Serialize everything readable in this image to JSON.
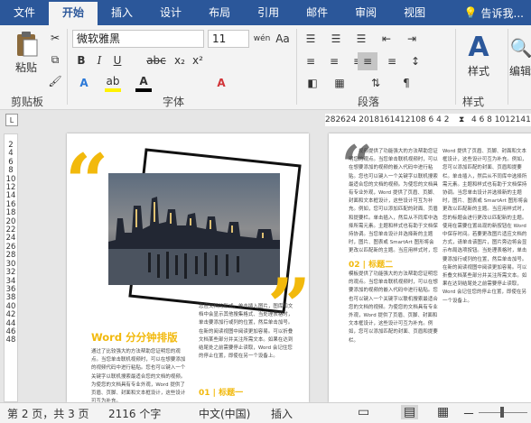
{
  "tabs": [
    "文件",
    "开始",
    "插入",
    "设计",
    "布局",
    "引用",
    "邮件",
    "审阅",
    "视图"
  ],
  "tell_me": "告诉我...",
  "ribbon": {
    "paste_label": "粘贴",
    "font_name": "微软雅黑",
    "font_size": "11",
    "styles_label": "样式",
    "edit_label": "编辑",
    "groups": {
      "clipboard": "剪贴板",
      "font": "字体",
      "paragraph": "段落",
      "styles": "样式"
    }
  },
  "ruler_numbers": "282624  2018161412108 6 4 2",
  "ruler_right": "4 6 8 10121416",
  "vruler_numbers": "2 4 6 8 10 12 14 16 18 20 22 24 26 28 30 32 34 36 38 40 42 44 46 48",
  "vruler_top": "2",
  "page_left": {
    "heading": "Word 分分钟排版",
    "section_heading": "01 | 标题一",
    "para_a": "通过了比较强大的方法帮助您证明您的观点。当您单击联机视频时，可以在想要添加的视频代码中进行粘贴。您也可以键入一个关键字以联机搜索最适合您的文档的视频。为使您的文档具有专业外观，Word 提供了页眉、页脚、封面和文本框设计，这些设计可互为补充。",
    "para_b": "您应文档的形式，单击插入图片，图库和文档中会显示其他搜集格式、当处理表格时，单击要添加行或列的位置，然后单击加号。在新的阅读视图中阅读更加容易。可以折叠文档某些部分并关注所需文本。如果在达到结尾处之前需要停止读取，Word 会记住您的停止位置，即使在另一个设备上。"
  },
  "page_right": {
    "section_heading": "02 | 标题二",
    "para_a": "　　视频提供了功能强大的方法帮助您证明您的观点。当您单击联机视频时，可以在想要添加的视频的嵌入代码中进行粘贴。您也可以键入一个关键字以联机搜索最适合您的文档的视频。为使您的文档具有专业外观，Word 提供了页眉、页脚、封面和文本框设计，这些设计可互为补充。例如，您可以添加匹配的封面、页眉和提要栏。单击插入，然后从不同库中选择所需元素。主题和样式也有助于文档保持协调。当您单击设计并选择新的主题时，图片、图表或 SmartArt 图形将会更改以匹配新的主题。当应用样式时，您的标题会进行更改以匹配新的主题。使用在需要位置出现的新按钮在 Word 中保存时间。若要更改图片适应文档的方式，请单击该图片，图片旁边将会显示布局选项按钮。",
    "para_b": "模板提供了功能强大的方法帮助您证明您的观点。当您单击联机视频时，可以在想要添加的视频的嵌入代码中进行粘贴。您也可以键入一个关键字以联机搜索最适合您的文档的视频。为使您的文档具有专业外观，Word 提供了页眉、页脚、封面和文本框设计，这些设计可互为补充。例如，您可以添加匹配的封面、页眉和提要栏。",
    "para_c": "Word 提供了页眉、页脚、封面和文本框设计，这些设计可互为补充。例如，您可以添加匹配的封面、页眉和提要栏。单击插入，然后从不同库中选择所需元素。主题和样式也有助于文档保持协调。当您单击设计并选择新的主题时，图片、图表或 SmartArt 图形将会更改以匹配新的主题。当应用样式时，您的标题会进行更改以匹配新的主题。使用在需要位置出现的新按钮在 Word 中保存时间。若要更改图片适应文档的方式，请单击该图片，图片旁边将会显示布局选项按钮。当处理表格时，单击要添加行或列的位置，然后单击加号。在新的阅读视图中阅读更加容易。可以折叠文档某些部分并关注所需文本。如果在达到结尾处之前需要停止读取，Word 会记住您的停止位置，即使在另一个设备上。"
  },
  "status": {
    "page": "第 2 页，共 3 页",
    "words": "2116 个字",
    "language": "中文(中国)",
    "mode": "插入",
    "zoom_minus": "－"
  },
  "colors": {
    "accent": "#2b579a",
    "gold": "#f2b90c",
    "text_color": "#d13438",
    "highlight": "#fff200"
  },
  "icons": [
    "paste-icon",
    "cut-icon",
    "copy-icon",
    "format-painter-icon",
    "bold-icon",
    "italic-icon",
    "underline-icon",
    "strikethrough-icon",
    "subscript-icon",
    "superscript-icon",
    "text-effects-icon",
    "highlight-icon",
    "font-color-icon",
    "bullets-icon",
    "numbering-icon",
    "align-left-icon",
    "center-icon",
    "align-right-icon",
    "justify-icon",
    "styles-icon",
    "find-icon",
    "lightbulb-icon"
  ]
}
